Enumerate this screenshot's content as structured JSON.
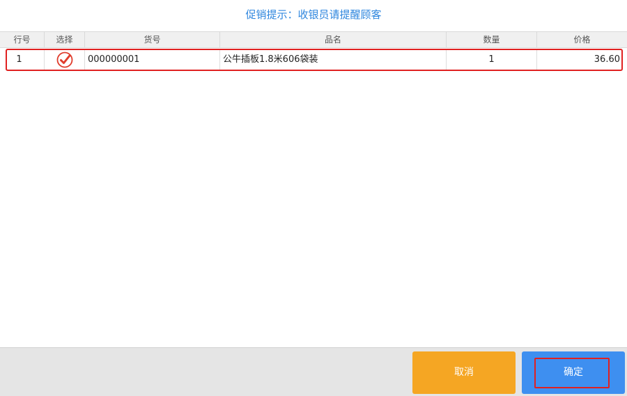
{
  "dialog": {
    "title": "促销提示：收银员请提醒顾客"
  },
  "table": {
    "columns": [
      "行号",
      "选择",
      "货号",
      "品名",
      "数量",
      "价格"
    ],
    "rows": [
      {
        "line_no": "1",
        "selected": true,
        "item_code": "000000001",
        "name": "公牛插板1.8米606袋装",
        "quantity": "1",
        "price": "36.60"
      }
    ]
  },
  "footer": {
    "cancel_label": "取消",
    "ok_label": "确定"
  },
  "icons": {
    "check": "checkmark-circle-icon"
  },
  "colors": {
    "title": "#2e86de",
    "cancel": "#f5a623",
    "ok": "#3e8ff0",
    "highlight": "#e02020",
    "check": "#e03c2c"
  }
}
